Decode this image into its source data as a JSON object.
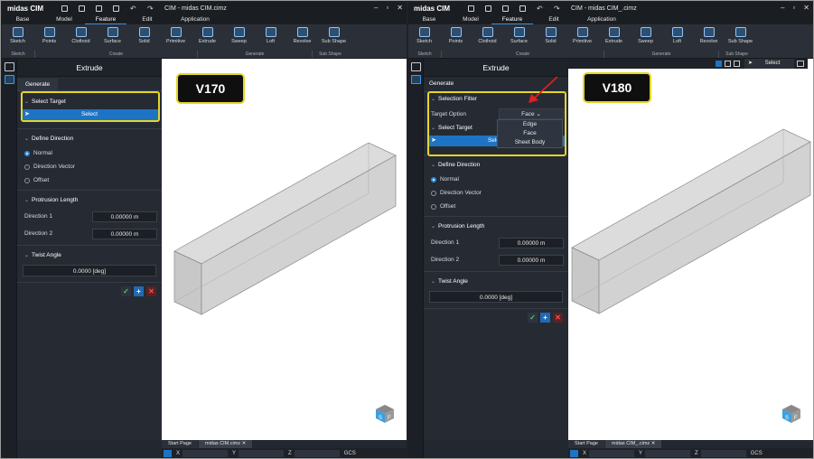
{
  "app": {
    "name": "midas CIM"
  },
  "left": {
    "title": "CIM - midas CIM.cimz",
    "menu": [
      "Base",
      "Model",
      "Feature",
      "Edit",
      "Application"
    ],
    "active_menu": "Feature",
    "tools": [
      "Sketch",
      "Points",
      "Clothoid",
      "Surface",
      "Solid",
      "Primitive",
      "Extrude",
      "Sweep",
      "Loft",
      "Revolve",
      "Sub Shape"
    ],
    "groups": [
      "Sketch",
      "Create",
      "Generate",
      "Sub Shape"
    ],
    "panel_title": "Extrude",
    "tab": "Generate",
    "select_target": "Select Target",
    "select_btn": "Select",
    "define_direction": "Define Direction",
    "dir_options": [
      "Normal",
      "Direction Vector",
      "Offset"
    ],
    "protrusion": "Protrusion Length",
    "direction1_label": "Direction 1",
    "direction1_value": "0.00000 m",
    "direction2_label": "Direction 2",
    "direction2_value": "0.00000 m",
    "twist": "Twist Angle",
    "twist_value": "0.0000 [deg]",
    "badge": "V170",
    "tabs": [
      "Start Page",
      "midas CIM.cimz"
    ],
    "status": {
      "x": "X",
      "y": "Y",
      "z": "Z",
      "gcs": "GCS"
    }
  },
  "right": {
    "title": "CIM - midas CIM_.cimz",
    "menu": [
      "Base",
      "Model",
      "Feature",
      "Edit",
      "Application"
    ],
    "active_menu": "Feature",
    "tools": [
      "Sketch",
      "Points",
      "Clothoid",
      "Surface",
      "Solid",
      "Primitive",
      "Extrude",
      "Sweep",
      "Loft",
      "Revolve",
      "Sub Shape"
    ],
    "groups": [
      "Sketch",
      "Create",
      "Generate",
      "Sub Shape"
    ],
    "panel_title": "Extrude",
    "tab": "Generate",
    "selection_filter": "Selection Filter",
    "target_option_label": "Target Option",
    "target_option_value": "Face",
    "filter_options": [
      "Edge",
      "Face",
      "Sheet Body"
    ],
    "select_target": "Select Target",
    "select_btn": "Select",
    "define_direction": "Define Direction",
    "dir_options": [
      "Normal",
      "Direction Vector",
      "Offset"
    ],
    "protrusion": "Protrusion Length",
    "direction1_label": "Direction 1",
    "direction1_value": "0.00000 m",
    "direction2_label": "Direction 2",
    "direction2_value": "0.00000 m",
    "twist": "Twist Angle",
    "twist_value": "0.0000 [deg]",
    "badge": "V180",
    "viewbar_select": "Select",
    "tabs": [
      "Start Page",
      "midas CIM_.cimz"
    ],
    "status": {
      "x": "X",
      "y": "Y",
      "z": "Z",
      "gcs": "GCS"
    }
  },
  "colors": {
    "accent": "#1e74c4",
    "highlight": "#e5d52a",
    "arrow": "#e02020"
  }
}
